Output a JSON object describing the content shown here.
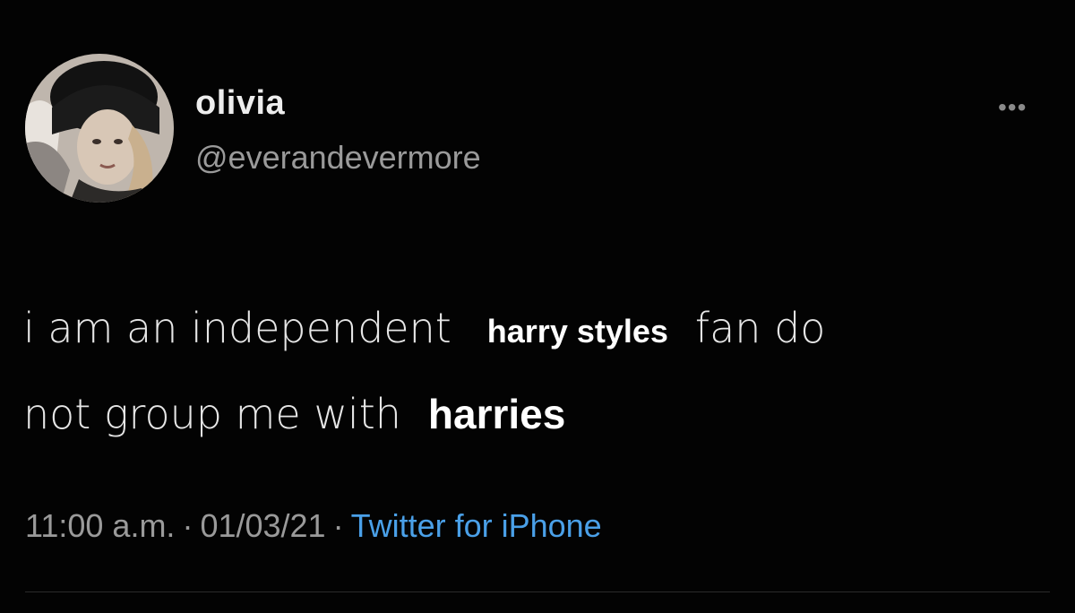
{
  "tweet": {
    "name": "olivia",
    "handle": "@everandevermore",
    "more_icon": "more-options-icon",
    "text": {
      "line1_before": "i am an independent",
      "line1_emph": "harry styles",
      "line1_after": "fan do",
      "line2_before": "not group me with",
      "line2_emph": "harries"
    },
    "time": "11:00 a.m.",
    "date": "01/03/21",
    "separator": "·",
    "source": "Twitter for iPhone",
    "colors": {
      "background": "#030303",
      "text": "#e6e6e6",
      "secondary": "#9a9a9a",
      "link": "#4aa0e8"
    }
  }
}
